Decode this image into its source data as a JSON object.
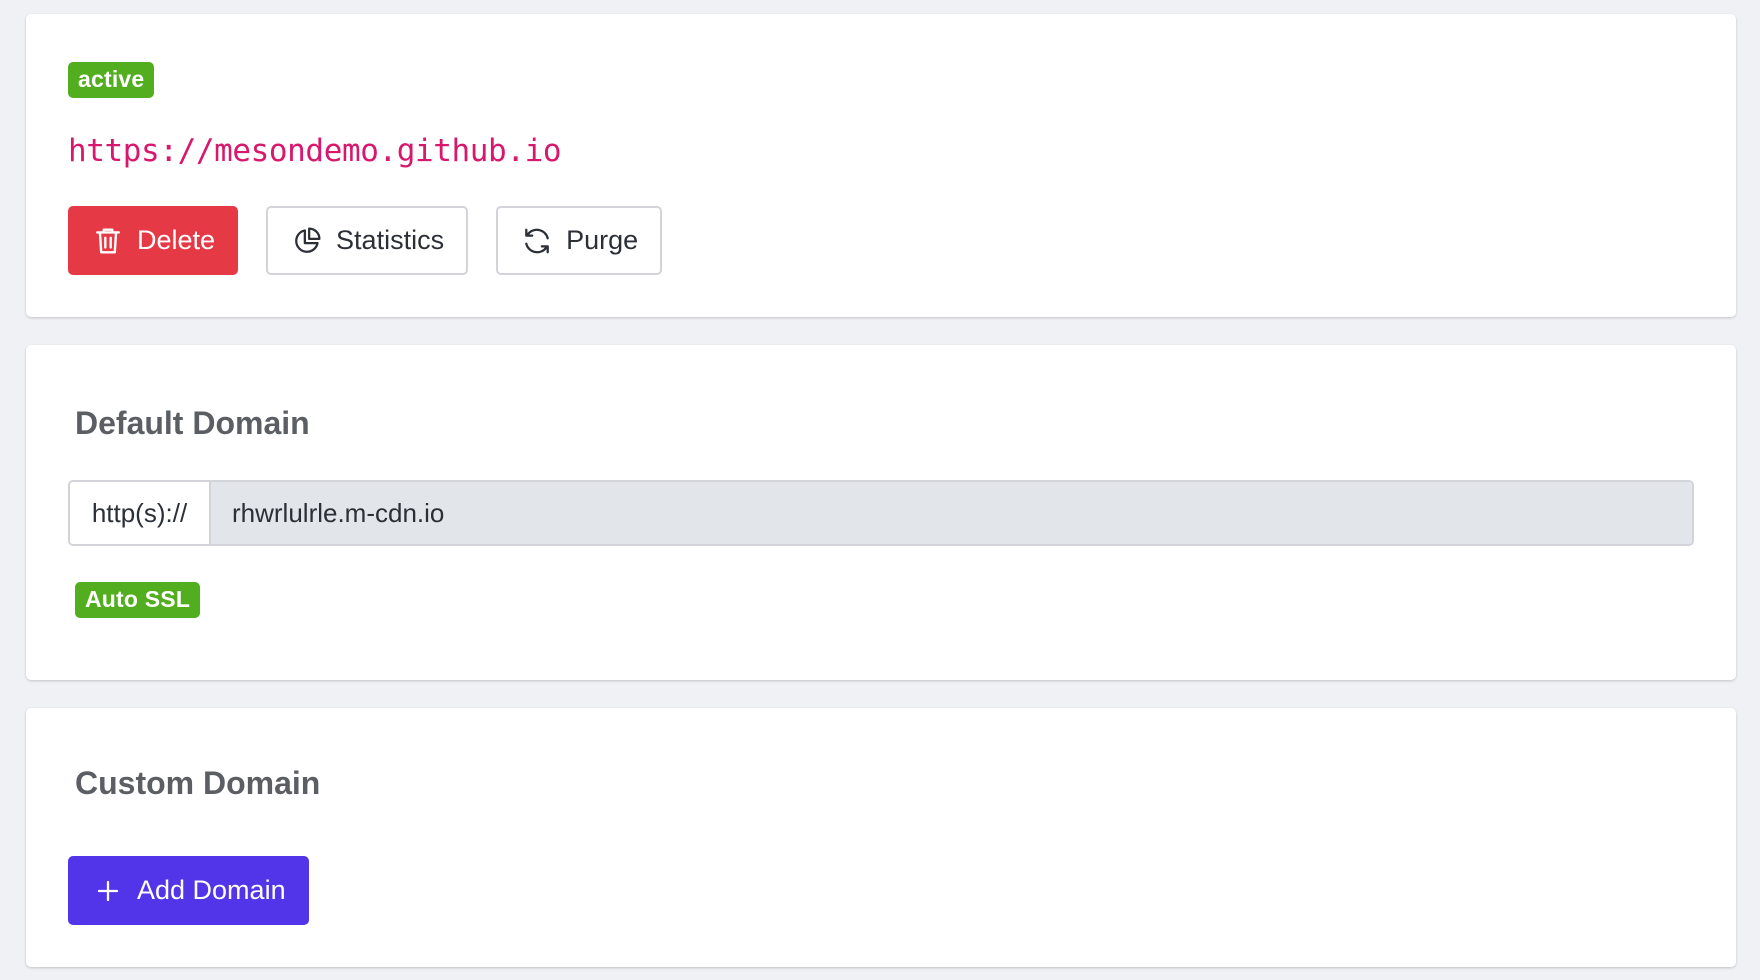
{
  "site": {
    "status_badge": "active",
    "url": "https://mesondemo.github.io",
    "buttons": {
      "delete": "Delete",
      "statistics": "Statistics",
      "purge": "Purge"
    }
  },
  "default_domain": {
    "title": "Default Domain",
    "prefix": "http(s)://",
    "value": "rhwrlulrle.m-cdn.io",
    "ssl_badge": "Auto SSL"
  },
  "custom_domain": {
    "title": "Custom Domain",
    "add_button": "Add Domain"
  },
  "icons": {
    "delete": "trash-icon",
    "statistics": "pie-chart-icon",
    "purge": "refresh-icon",
    "add": "plus-icon"
  },
  "colors": {
    "page_bg": "#f0f1f5",
    "success": "#52ae1f",
    "danger": "#e53945",
    "primary": "#5234e9",
    "url_pink": "#d8186c"
  }
}
